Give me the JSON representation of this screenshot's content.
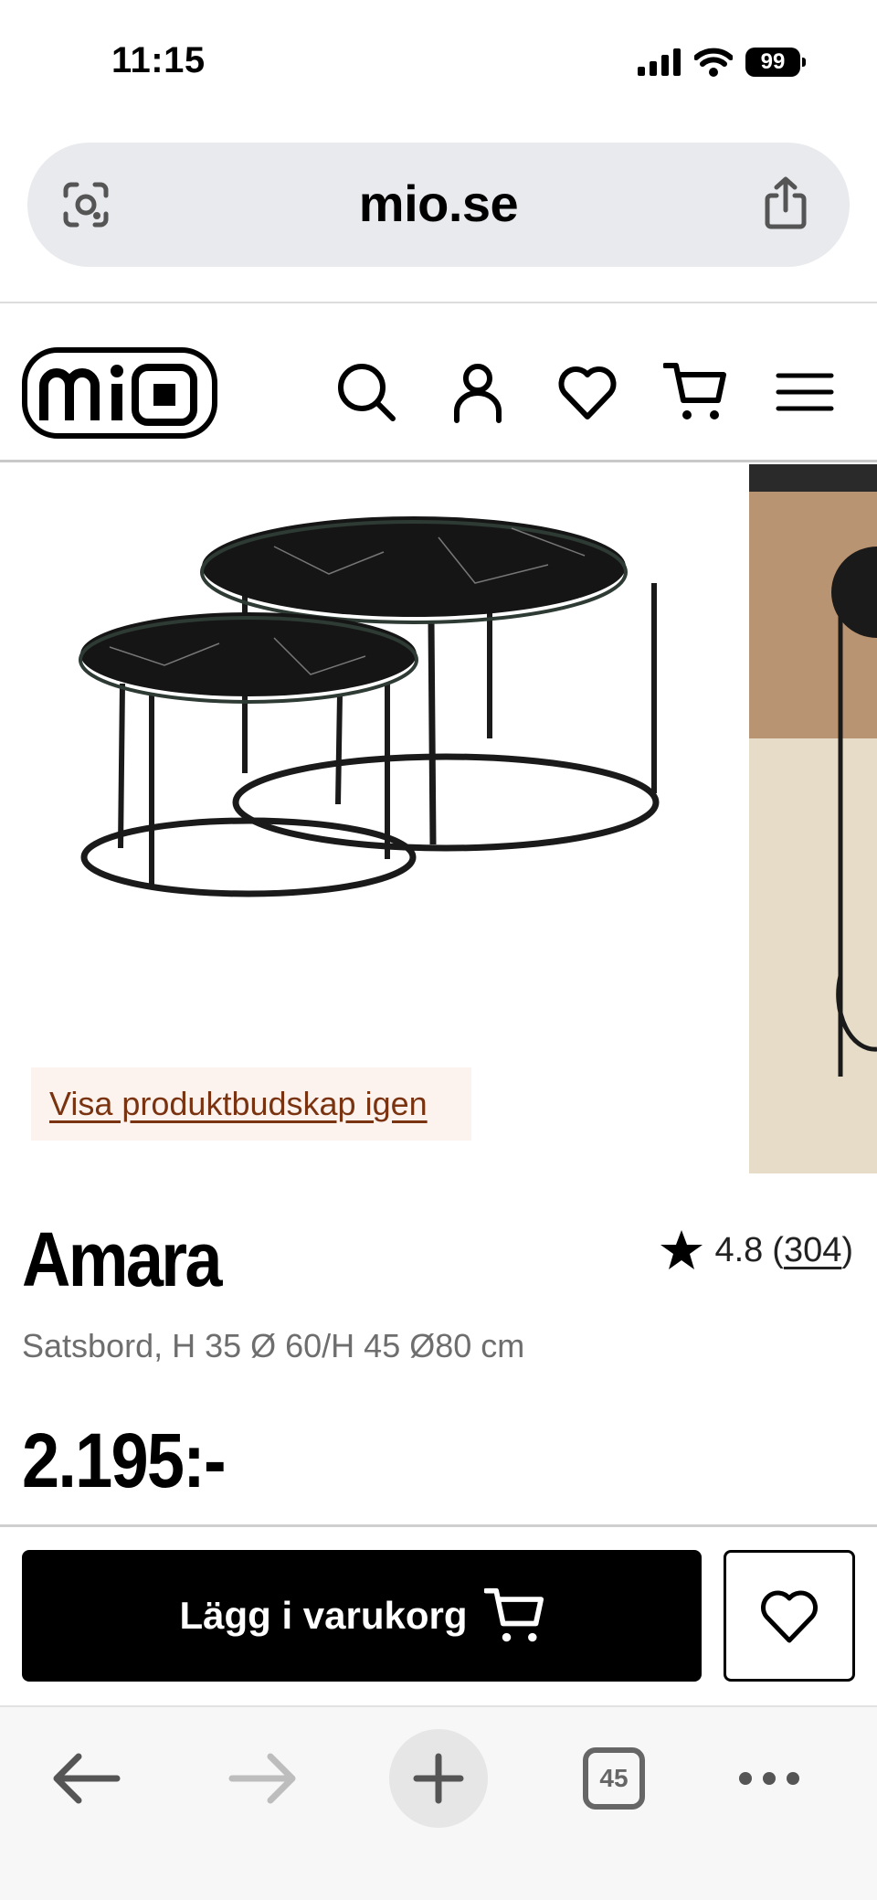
{
  "status_bar": {
    "time": "11:15",
    "battery": "99"
  },
  "browser": {
    "url": "mio.se",
    "tabs_count": "45"
  },
  "header": {
    "logo_text": "mio"
  },
  "gallery": {
    "show_message_link": "Visa produktbudskap igen"
  },
  "product": {
    "name": "Amara",
    "rating": "4.8",
    "review_count": "304",
    "subtitle": "Satsbord, H 35 Ø 60/H 45 Ø80 cm",
    "price": "2.195:-"
  },
  "actions": {
    "add_to_cart_label": "Lägg i varukorg"
  },
  "colors": {
    "primary_button": "#000000",
    "message_bg": "#fdf3ee",
    "message_link": "#7a3310",
    "url_bar_bg": "#e8eaed"
  }
}
